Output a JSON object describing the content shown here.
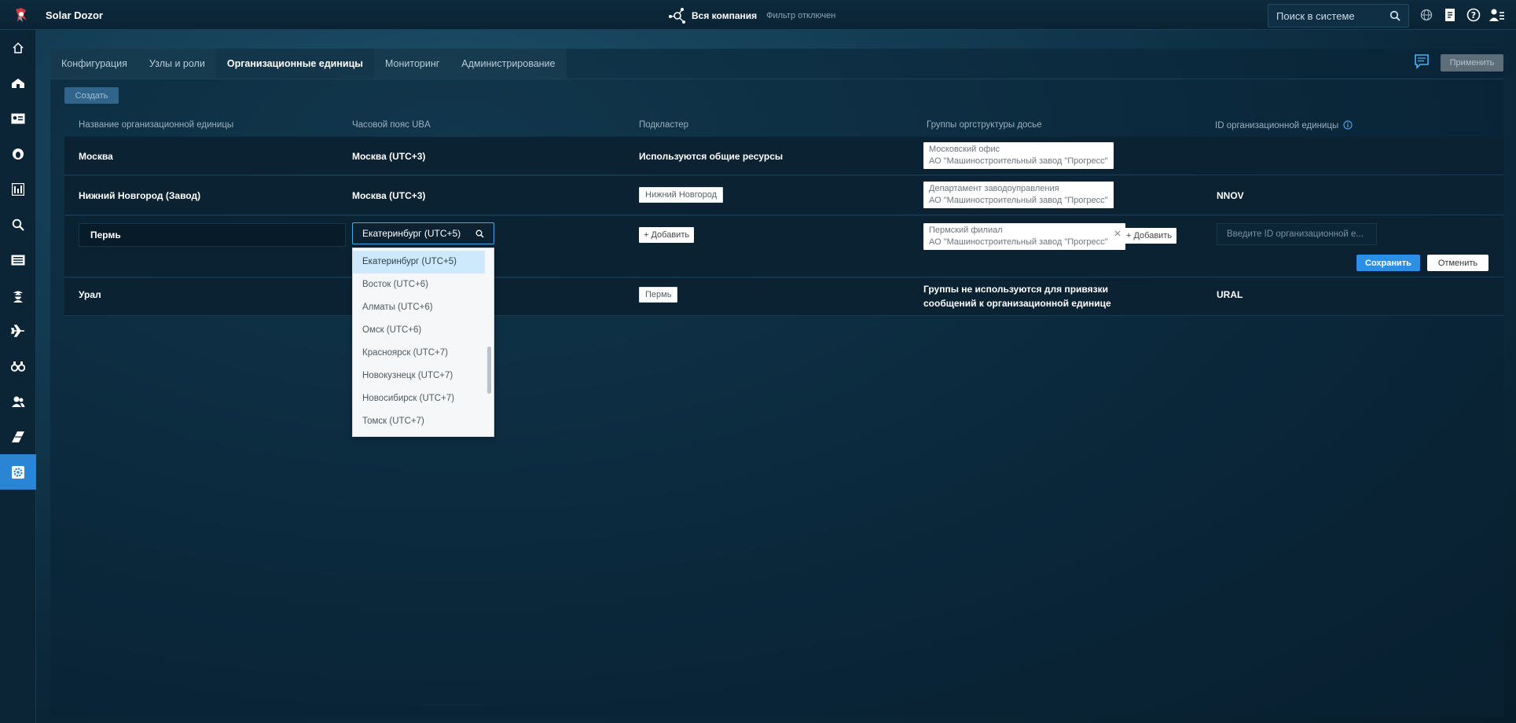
{
  "app": {
    "title": "Solar Dozor"
  },
  "header": {
    "company": "Вся компания",
    "filter_status": "Фильтр отключен",
    "search_placeholder": "Поиск в системе"
  },
  "sidebar": {
    "items": [
      {
        "icon": "home-icon"
      },
      {
        "icon": "dashboard-icon"
      },
      {
        "icon": "profile-card-icon"
      },
      {
        "icon": "bug-icon"
      },
      {
        "icon": "reports-icon"
      },
      {
        "icon": "search-icon"
      },
      {
        "icon": "list-icon"
      },
      {
        "icon": "agent-icon"
      },
      {
        "icon": "plane-icon"
      },
      {
        "icon": "binoculars-icon"
      },
      {
        "icon": "users-icon"
      },
      {
        "icon": "eraser-icon"
      },
      {
        "icon": "settings-icon",
        "active": true
      }
    ]
  },
  "tabs": [
    {
      "label": "Конфигурация"
    },
    {
      "label": "Узлы и роли"
    },
    {
      "label": "Организационные единицы",
      "active": true
    },
    {
      "label": "Мониторинг"
    },
    {
      "label": "Администрирование"
    }
  ],
  "toolbar": {
    "apply_label": "Применить",
    "create_label": "Создать"
  },
  "columns": {
    "name": "Название организационной единицы",
    "timezone": "Часовой пояс UBA",
    "subcluster": "Подкластер",
    "groups": "Группы оргструктуры досье",
    "id": "ID организационной единицы"
  },
  "rows": [
    {
      "name": "Москва",
      "timezone": "Москва (UTC+3)",
      "subcluster": "Используются общие ресурсы",
      "group_line1": "Московский офис",
      "group_line2": "АО \"Машиностроительный завод \"Прогресс\"",
      "id": ""
    },
    {
      "name": "Нижний Новгород (Завод)",
      "timezone": "Москва (UTC+3)",
      "subcluster": "Нижний Новгород",
      "group_line1": "Департамент заводоуправления",
      "group_line2": "АО \"Машиностроительный завод \"Прогресс\"",
      "id": "NNOV"
    },
    {
      "name": "Урал",
      "subcluster": "Пермь",
      "groups_note": "Группы не используются для привязки сообщений к организационной единице",
      "id": "URAL"
    }
  ],
  "edit_row": {
    "name_value": "Пермь",
    "timezone_value": "Екатеринбург (UTC+5)",
    "add_label": "+ Добавить",
    "group_line1": "Пермский филиал",
    "group_line2": "АО \"Машиностроительный завод \"Прогресс\"",
    "group_add_label": "+ Добавить",
    "id_placeholder": "Введите ID организационной е...",
    "save_label": "Сохранить",
    "cancel_label": "Отменить"
  },
  "timezone_options": [
    {
      "label": "Екатеринбург (UTC+5)",
      "selected": true
    },
    {
      "label": "Восток (UTC+6)"
    },
    {
      "label": "Алматы (UTC+6)"
    },
    {
      "label": "Омск (UTC+6)"
    },
    {
      "label": "Красноярск (UTC+7)"
    },
    {
      "label": "Новокузнецк (UTC+7)"
    },
    {
      "label": "Новосибирск (UTC+7)"
    },
    {
      "label": "Томск (UTC+7)"
    }
  ],
  "colors": {
    "accent": "#2c8fe6",
    "active_sidebar": "#2a86d4",
    "selected_option": "#cde9fb"
  }
}
